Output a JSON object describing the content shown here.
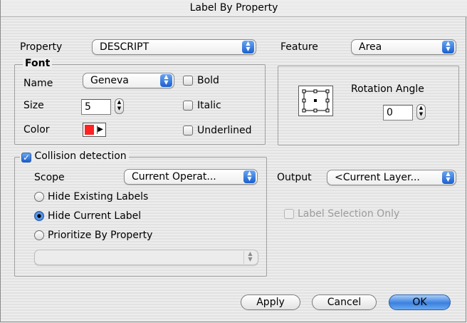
{
  "window": {
    "title": "Label By Property"
  },
  "property": {
    "label": "Property",
    "value": "DESCRIPT"
  },
  "feature": {
    "label": "Feature",
    "value": "Area"
  },
  "font": {
    "group_title": "Font",
    "name_label": "Name",
    "name_value": "Geneva",
    "size_label": "Size",
    "size_value": "5",
    "color_label": "Color",
    "color_hex": "#ff2020",
    "bold_label": "Bold",
    "bold_checked": false,
    "italic_label": "Italic",
    "italic_checked": false,
    "underlined_label": "Underlined",
    "underlined_checked": false
  },
  "rotation": {
    "label": "Rotation Angle",
    "value": "0"
  },
  "collision": {
    "label": "Collision detection",
    "checked": true,
    "scope_label": "Scope",
    "scope_value": "Current Operat...",
    "options": [
      {
        "label": "Hide Existing Labels",
        "selected": false
      },
      {
        "label": "Hide Current Label",
        "selected": true
      },
      {
        "label": "Prioritize By Property",
        "selected": false
      }
    ],
    "priority_value": ""
  },
  "output": {
    "label": "Output",
    "value": "<Current Layer...",
    "selection_only_label": "Label Selection Only",
    "selection_only_enabled": false
  },
  "buttons": {
    "apply": "Apply",
    "cancel": "Cancel",
    "ok": "OK"
  },
  "icons": {
    "popup_arrows": "up-down-arrows-icon",
    "stepper": "stepper-arrows-icon",
    "color_menu": "triangle-right-icon",
    "rotation_preview": "rotation-handle-box-icon"
  }
}
